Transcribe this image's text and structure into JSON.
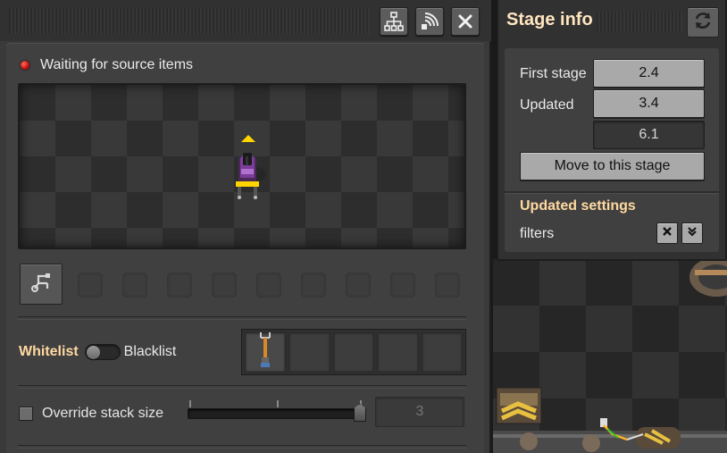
{
  "main": {
    "toolbar": {
      "blueprint_icon": "hierarchy-icon",
      "signal_icon": "radio-signal-icon",
      "close_icon": "close-icon"
    },
    "status": {
      "text": "Waiting for source items",
      "color": "#d21414"
    },
    "circuit_icon": "circuit-network-icon",
    "filter": {
      "whitelist_label": "Whitelist",
      "blacklist_label": "Blacklist",
      "mode": "whitelist",
      "slots": [
        {
          "item_icon": "inserter-item-icon"
        },
        {
          "item_icon": ""
        },
        {
          "item_icon": ""
        },
        {
          "item_icon": ""
        },
        {
          "item_icon": ""
        }
      ]
    },
    "override": {
      "label": "Override stack size",
      "checked": false,
      "value": "3"
    }
  },
  "stage_info": {
    "title": "Stage info",
    "refresh_icon": "refresh-icon",
    "first_stage_label": "First stage",
    "first_stage_value": "2.4",
    "updated_label": "Updated",
    "updated_value": "3.4",
    "current_stage": "6.1",
    "move_button": "Move to this stage",
    "updated_settings_title": "Updated settings",
    "setting_name": "filters",
    "reset_icon": "close-icon",
    "expand_icon": "chevron-down-double-icon"
  },
  "colors": {
    "accent_orange": "#ffd9a0",
    "title_color": "#ffe6c0",
    "panel": "#404040"
  }
}
